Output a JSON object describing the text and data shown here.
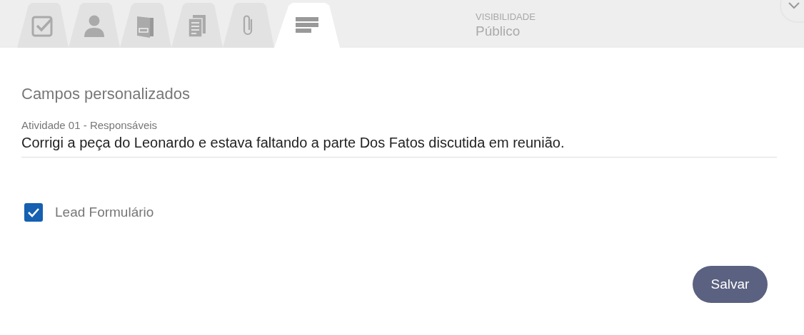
{
  "tabs": [
    {
      "kind": "checklist",
      "selected": false
    },
    {
      "kind": "person",
      "selected": false
    },
    {
      "kind": "folder",
      "selected": false
    },
    {
      "kind": "documents",
      "selected": false
    },
    {
      "kind": "attachment",
      "selected": false
    },
    {
      "kind": "fields",
      "selected": true
    }
  ],
  "visibility": {
    "label": "VISIBILIDADE",
    "value": "Público"
  },
  "section_title": "Campos personalizados",
  "field": {
    "label": "Atividade 01 - Responsáveis",
    "value": "Corrigi a peça do Leonardo e estava faltando a parte Dos Fatos discutida em reunião."
  },
  "checkbox": {
    "label": "Lead Formulário",
    "checked": true
  },
  "save_button": "Salvar"
}
